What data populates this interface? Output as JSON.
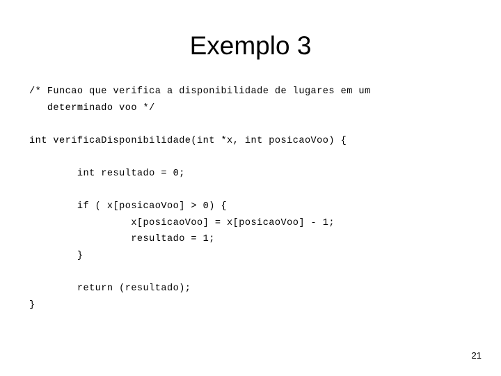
{
  "slide": {
    "title": "Exemplo 3",
    "page_number": "21",
    "background_color": "#ffffff",
    "text_color": "#000000",
    "code_lines": [
      "/* Funcao que verifica a disponibilidade de lugares em um",
      "   determinado voo */",
      "",
      "int verificaDisponibilidade(int *x, int posicaoVoo) {",
      "",
      "        int resultado = 0;",
      "",
      "        if ( x[posicaoVoo] > 0) {",
      "                 x[posicaoVoo] = x[posicaoVoo] - 1;",
      "                 resultado = 1;",
      "        }",
      "",
      "        return (resultado);",
      "}"
    ]
  }
}
